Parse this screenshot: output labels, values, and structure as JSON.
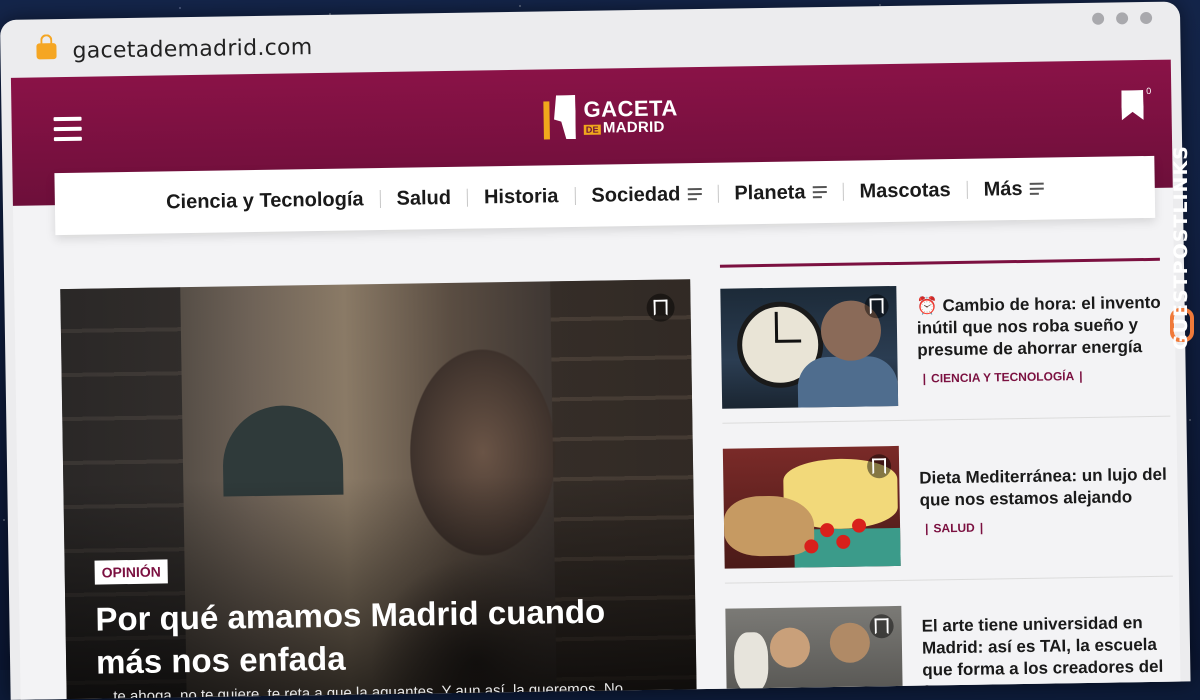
{
  "browser": {
    "url": "gacetademadrid.com"
  },
  "site": {
    "logo_line1": "GACETA",
    "logo_de": "DE",
    "logo_line2": "MADRID",
    "bookmark_count": "0"
  },
  "nav": {
    "items": [
      {
        "label": "Ciencia y Tecnología"
      },
      {
        "label": "Salud"
      },
      {
        "label": "Historia"
      },
      {
        "label": "Sociedad"
      },
      {
        "label": "Planeta"
      },
      {
        "label": "Mascotas"
      },
      {
        "label": "Más"
      }
    ]
  },
  "hero": {
    "category": "OPINIÓN",
    "title": "Por qué amamos Madrid cuando más nos enfada",
    "excerpt": "... te ahoga, no te quiere, te reta a que la aguantes. Y aun así, la queremos. No"
  },
  "side": {
    "articles": [
      {
        "title": "⏰ Cambio de hora: el invento inútil que nos roba sueño y presume de ahorrar energía",
        "category": "CIENCIA Y TECNOLOGÍA"
      },
      {
        "title": "Dieta Mediterránea: un lujo del que nos estamos alejando",
        "category": "SALUD"
      },
      {
        "title": "El arte tiene universidad en Madrid: así es TAI, la escuela que forma a los creadores del fut...",
        "category": ""
      }
    ]
  },
  "watermark": {
    "text": "GUESTPOSTLINKS"
  },
  "colors": {
    "brand": "#7b1040",
    "accent": "#f0a81c"
  }
}
